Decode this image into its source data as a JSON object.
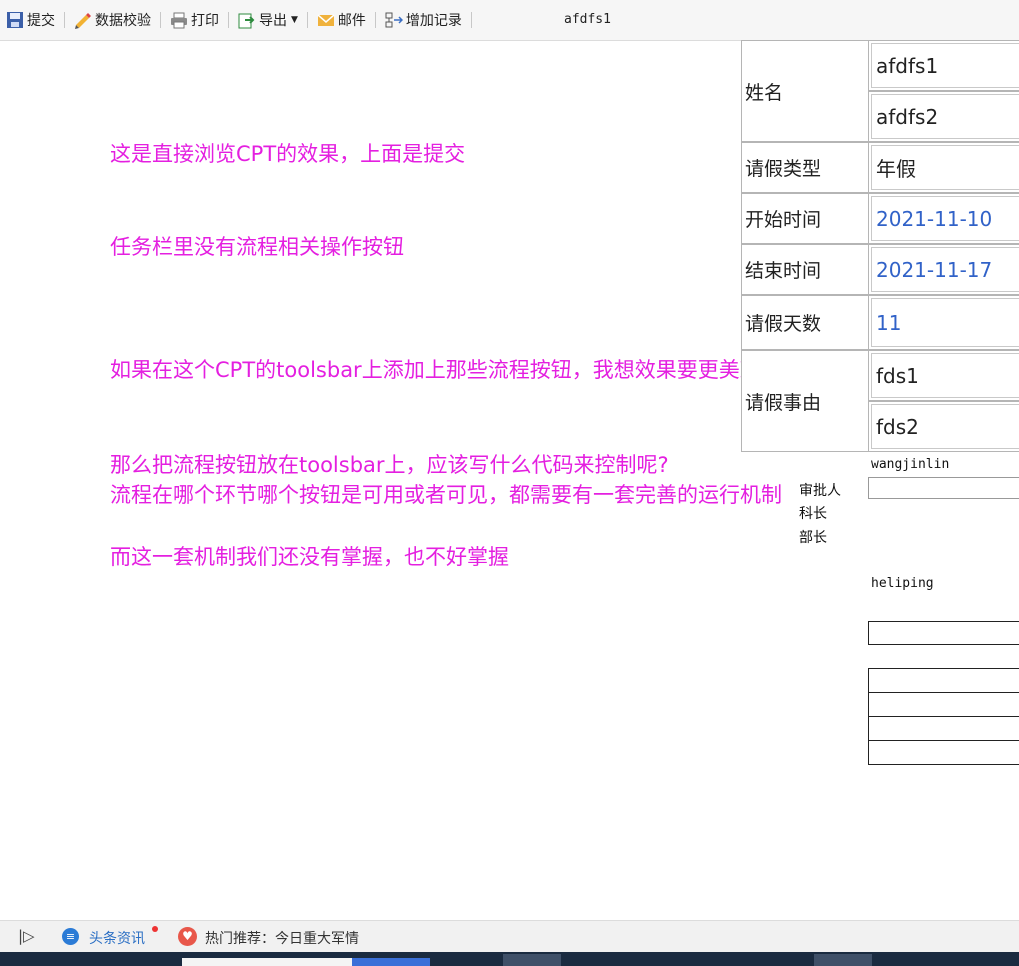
{
  "toolbar": {
    "submit": "提交",
    "validate": "数据校验",
    "print": "打印",
    "export": "导出",
    "mail": "邮件",
    "add_record": "增加记录",
    "title": "afdfs1"
  },
  "notes": [
    "这是直接浏览CPT的效果，上面是提交",
    "任务栏里没有流程相关操作按钮",
    "如果在这个CPT的toolsbar上添加上那些流程按钮，我想效果要更美观一些",
    "那么把流程按钮放在toolsbar上，应该写什么代码来控制呢?",
    "流程在哪个环节哪个按钮是可用或者可见，都需要有一套完善的运行机制",
    "而这一套机制我们还没有掌握，也不好掌握"
  ],
  "form": {
    "name_label": "姓名",
    "name_1": "afdfs1",
    "name_2": "afdfs2",
    "leave_type_label": "请假类型",
    "leave_type": "年假",
    "start_label": "开始时间",
    "start": "2021-11-10",
    "end_label": "结束时间",
    "end": "2021-11-17",
    "days_label": "请假天数",
    "days": "11",
    "reason_label": "请假事由",
    "reason_1": "fds1",
    "reason_2": "fds2"
  },
  "approval": {
    "user1": "wangjinlin",
    "approver_label": "审批人",
    "section_chief": "科长",
    "dept_head": "部长",
    "user2": "heliping"
  },
  "statusbar": {
    "news": "头条资讯",
    "hot": "热门推荐：今日重大军情"
  },
  "colors": {
    "annotation": "#e41fe0",
    "link_blue": "#3162c8"
  }
}
